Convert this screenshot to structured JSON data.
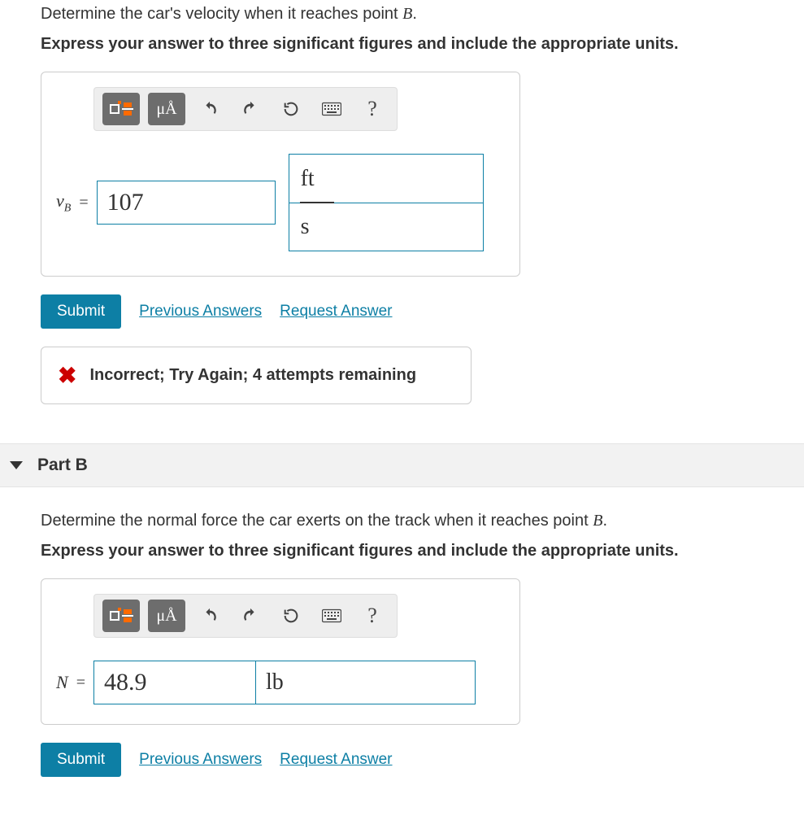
{
  "partA": {
    "question": "Determine the car's velocity when it reaches point B.",
    "instruction": "Express your answer to three significant figures and include the appropriate units.",
    "prefix_var": "v",
    "prefix_sub": "B",
    "equals": "=",
    "value": "107",
    "unit_top": "ft",
    "unit_bottom": "s",
    "toolbar": {
      "special": "μÅ",
      "help": "?"
    },
    "submit": "Submit",
    "prev_answers": "Previous Answers",
    "request_answer": "Request Answer",
    "feedback": "Incorrect; Try Again; 4 attempts remaining"
  },
  "partB": {
    "header": "Part B",
    "question": "Determine the normal force the car exerts on the track when it reaches point B.",
    "instruction": "Express your answer to three significant figures and include the appropriate units.",
    "prefix_var": "N",
    "equals": "=",
    "value": "48.9",
    "unit": "lb",
    "toolbar": {
      "special": "μÅ",
      "help": "?"
    },
    "submit": "Submit",
    "prev_answers": "Previous Answers",
    "request_answer": "Request Answer"
  }
}
